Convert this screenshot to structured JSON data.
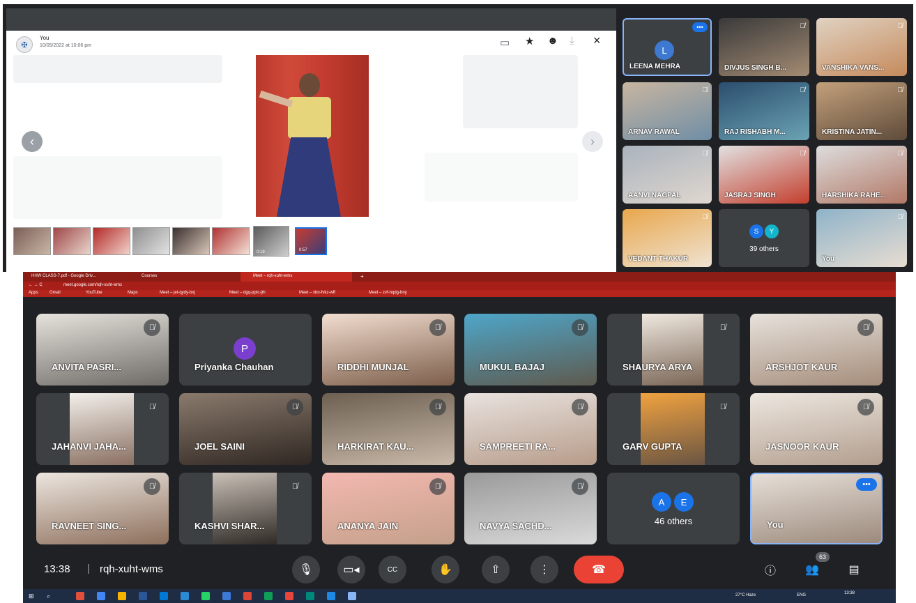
{
  "top": {
    "viewer": {
      "sender": "You",
      "date": "10/05/2022 at 10:06 pm",
      "video_durations": [
        "0:19",
        "0:57"
      ]
    },
    "tiles": [
      {
        "name": "LEENA MEHRA",
        "initial": "L"
      },
      {
        "name": "DIVJUS SINGH B..."
      },
      {
        "name": "VANSHIKA VANS..."
      },
      {
        "name": "ARNAV RAWAL"
      },
      {
        "name": "RAJ RISHABH M..."
      },
      {
        "name": "KRISTINA JATIN..."
      },
      {
        "name": "AANVI NAGPAL"
      },
      {
        "name": "JASRAJ SINGH"
      },
      {
        "name": "HARSHIKA RAHE..."
      },
      {
        "name": "VEDANT THAKUR"
      },
      {
        "name": "39 others",
        "initials": [
          "S",
          "Y"
        ]
      },
      {
        "name": "You"
      }
    ]
  },
  "bottom": {
    "browser": {
      "tabs": [
        "HHW CLASS-7.pdf - Google Driv...",
        "Courses",
        "Meet – rqh-xuht-wms"
      ],
      "url": "meet.google.com/rqh-xuht-wms",
      "bookmarks": [
        "Apps",
        "Gmail",
        "YouTube",
        "Maps",
        "Meet – jet-qydy-bxj",
        "Meet – dgq-pptc-jth",
        "Meet – xbn-fvkz-wff",
        "Meet – zvf-hqdg-bny"
      ]
    },
    "tiles": [
      {
        "name": "ANVITA PASRI..."
      },
      {
        "name": "Priyanka Chauhan",
        "initial": "P"
      },
      {
        "name": "RIDDHI MUNJAL"
      },
      {
        "name": "MUKUL BAJAJ"
      },
      {
        "name": "SHAURYA ARYA"
      },
      {
        "name": "ARSHJOT KAUR"
      },
      {
        "name": "JAHANVI JAHA..."
      },
      {
        "name": "JOEL SAINI"
      },
      {
        "name": "HARKIRAT KAU..."
      },
      {
        "name": "SAMPREETI RA..."
      },
      {
        "name": "GARV GUPTA"
      },
      {
        "name": "JASNOOR KAUR"
      },
      {
        "name": "RAVNEET SING..."
      },
      {
        "name": "KASHVI SHAR..."
      },
      {
        "name": "ANANYA JAIN"
      },
      {
        "name": "NAVYA SACHD..."
      },
      {
        "name": "46 others",
        "initials": [
          "A",
          "E"
        ]
      },
      {
        "name": "You"
      }
    ],
    "controls": {
      "time": "13:38",
      "separator": "|",
      "meeting_code": "rqh-xuht-wms",
      "participant_count": "63"
    },
    "taskbar": {
      "weather": "27°C Haze",
      "lang": "ENG",
      "clock": "13:38"
    }
  },
  "colors": {
    "meet_bg": "#202124",
    "tile_bg": "#3c4043",
    "accent_blue": "#1a73e8",
    "end_call_red": "#ea4335",
    "browser_red": "#a81e19"
  }
}
